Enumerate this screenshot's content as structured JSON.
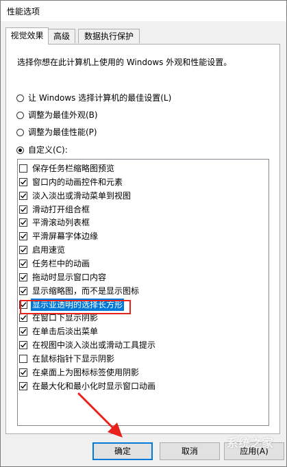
{
  "window": {
    "title": "性能选项"
  },
  "tabs": [
    {
      "label": "视觉效果",
      "active": true
    },
    {
      "label": "高级",
      "active": false
    },
    {
      "label": "数据执行保护",
      "active": false
    }
  ],
  "description": "选择你想在此计算机上使用的 Windows 外观和性能设置。",
  "radio_options": [
    {
      "label": "让 Windows 选择计算机的最佳设置(L)",
      "selected": false
    },
    {
      "label": "调整为最佳外观(B)",
      "selected": false
    },
    {
      "label": "调整为最佳性能(P)",
      "selected": false
    },
    {
      "label": "自定义(C):",
      "selected": true
    }
  ],
  "effects": [
    {
      "label": "保存任务栏缩略图预览",
      "checked": false,
      "selected": false
    },
    {
      "label": "窗口内的动画控件和元素",
      "checked": true,
      "selected": false
    },
    {
      "label": "淡入淡出或滑动菜单到视图",
      "checked": true,
      "selected": false
    },
    {
      "label": "滑动打开组合框",
      "checked": true,
      "selected": false
    },
    {
      "label": "平滑滚动列表框",
      "checked": true,
      "selected": false
    },
    {
      "label": "平滑屏幕字体边缘",
      "checked": true,
      "selected": false
    },
    {
      "label": "启用速览",
      "checked": true,
      "selected": false
    },
    {
      "label": "任务栏中的动画",
      "checked": true,
      "selected": false
    },
    {
      "label": "拖动时显示窗口内容",
      "checked": true,
      "selected": false
    },
    {
      "label": "显示缩略图，而不是显示图标",
      "checked": true,
      "selected": false
    },
    {
      "label": "显示亚透明的选择长方形",
      "checked": true,
      "selected": true
    },
    {
      "label": "在窗口下显示阴影",
      "checked": true,
      "selected": false
    },
    {
      "label": "在单击后淡出菜单",
      "checked": true,
      "selected": false
    },
    {
      "label": "在视图中淡入淡出或滑动工具提示",
      "checked": true,
      "selected": false
    },
    {
      "label": "在鼠标指针下显示阴影",
      "checked": false,
      "selected": false
    },
    {
      "label": "在桌面上为图标标签使用阴影",
      "checked": true,
      "selected": false
    },
    {
      "label": "在最大化和最小化时显示窗口动画",
      "checked": true,
      "selected": false
    }
  ],
  "buttons": {
    "ok": "确定",
    "cancel": "取消",
    "apply": "应用(A)"
  },
  "annotation": {
    "highlight_color": "#e8211d",
    "arrow_color": "#e8211d"
  },
  "watermark": {
    "line1": "系统之家",
    "line2": ""
  },
  "colors": {
    "selection": "#0078d7",
    "accent_border": "#0078d7"
  }
}
